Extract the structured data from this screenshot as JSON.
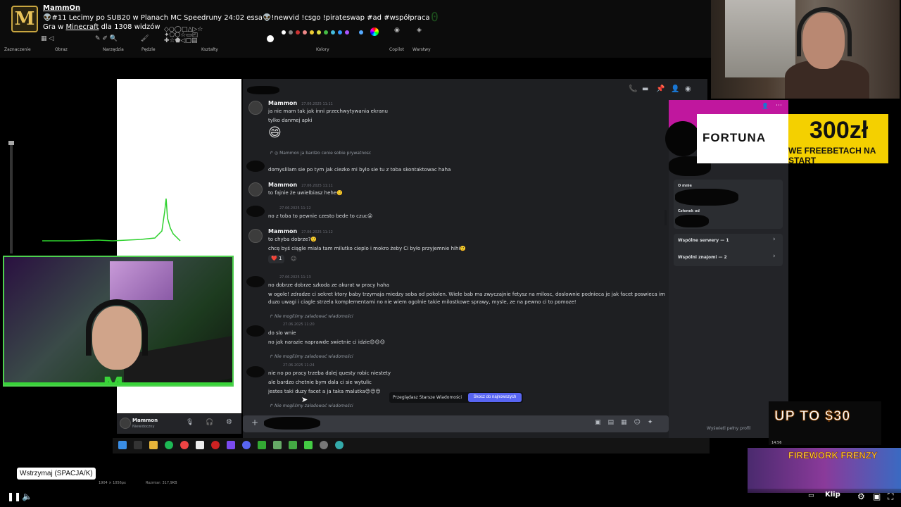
{
  "stream": {
    "channel": "MammOn",
    "logo_letter": "M",
    "title": "👽#11 Lecimy po SUB20 w Planach MC Speedruny 24:02 essa👽!newvid !csgo !pirateswap #ad #współpraca",
    "sub_prefix": "Gra w",
    "game": "Minecraft",
    "sub_suffix": "dla 1308 widzów"
  },
  "ribbon": {
    "labels": [
      "Zaznaczenie",
      "Obraz",
      "Narzędzia",
      "Pędzle",
      "Kształty",
      "Kolory",
      "Copilot",
      "Warstwy"
    ]
  },
  "discord": {
    "messages": [
      {
        "name": "Mammon",
        "time": "27.06.2025 11:11",
        "lines": [
          "ja nie mam tak jak inni przechwytywania ekranu",
          "tylko danmej apki"
        ],
        "emoji": "😄"
      },
      {
        "reply": "Mammon ja bardzo cenie sobie prywatnosc",
        "lines": [
          "domyslilam sie po tym jak ciezko mi bylo sie tu z toba skontaktowac haha"
        ]
      },
      {
        "name": "Mammon",
        "time": "27.06.2025 11:11",
        "lines": [
          "to fajnie że uwielbiasz hehe🙂"
        ]
      },
      {
        "time": "27.06.2025 11:12",
        "lines": [
          "no z toba to pewnie czesto bede to czuc😜"
        ]
      },
      {
        "name": "Mammon",
        "time": "27.06.2025 11:12",
        "lines": [
          "to chyba dobrze?🙂",
          "chcę byś ciągle miała tam milutko cieplo i mokro żeby Ci było przyjemnie hihi🙂"
        ],
        "reaction": "❤️ 1"
      },
      {
        "time": "27.06.2025 11:13",
        "lines": [
          "no dobrze dobrze szkoda ze akurat w pracy haha",
          "w ogole! zdradze ci sekret ktory baby trzymaja miedzy soba od pokolen. Wiele bab ma zwyczajnie fetysz na milosc, doslownie podnieca je jak facet poswieca im",
          "duzo uwagi i ciagle strzela komplementami no nie wiem ogolnie takie milostkowe sprawy, mysle, ze na pewno ci to pomoze!"
        ]
      },
      {
        "sys": "Nie mogliśmy załadować wiadomości",
        "time": "27.06.2025 11:20",
        "lines": [
          "do slo wnie",
          "no jak narazie naprawde swietnie ci idzie😊😊😊"
        ]
      },
      {
        "sys": "Nie mogliśmy załadować wiadomości",
        "time": "27.06.2025 11:24",
        "lines": [
          "nie no po pracy trzeba dalej questy robic niestety",
          "ale bardzo chetnie bym dala ci sie wytulic",
          "jestes taki duzy facet a ja taka malutka😊😊😊"
        ]
      },
      {
        "sys": "Nie mogliśmy załadować wiadomości"
      }
    ],
    "older_text": "Przeglądasz Starsze Wiadomości",
    "jump_label": "Skocz do najnowszych",
    "user_name": "Mammon",
    "user_status": "Niewidoczny",
    "profile": {
      "about_label": "O mnie",
      "member_since_label": "Członek od",
      "servers": "Wspólne serwery — 1",
      "friends": "Wspólni znajomi — 2",
      "full_profile": "Wyświetl pełny profil"
    }
  },
  "ads": {
    "fortuna_logo": "FORTUNA",
    "fortuna_amount": "300zł",
    "fortuna_sub": "WE FREEBETACH NA START",
    "upto": "UP TO $30",
    "firework": "FIREWORK FRENZY"
  },
  "player": {
    "tooltip": "Wstrzymaj (SPACJA/K)",
    "dimensions": "1904 × 1056px",
    "size": "Rozmiar: 317,9KB",
    "clip": "Klip",
    "time": "14:56"
  },
  "colors": {
    "discord_bg": "#1e1f22",
    "accent": "#5865f2",
    "banner": "#c0179e",
    "fortuna": "#f4d000",
    "cam_border": "#4ed14e"
  }
}
